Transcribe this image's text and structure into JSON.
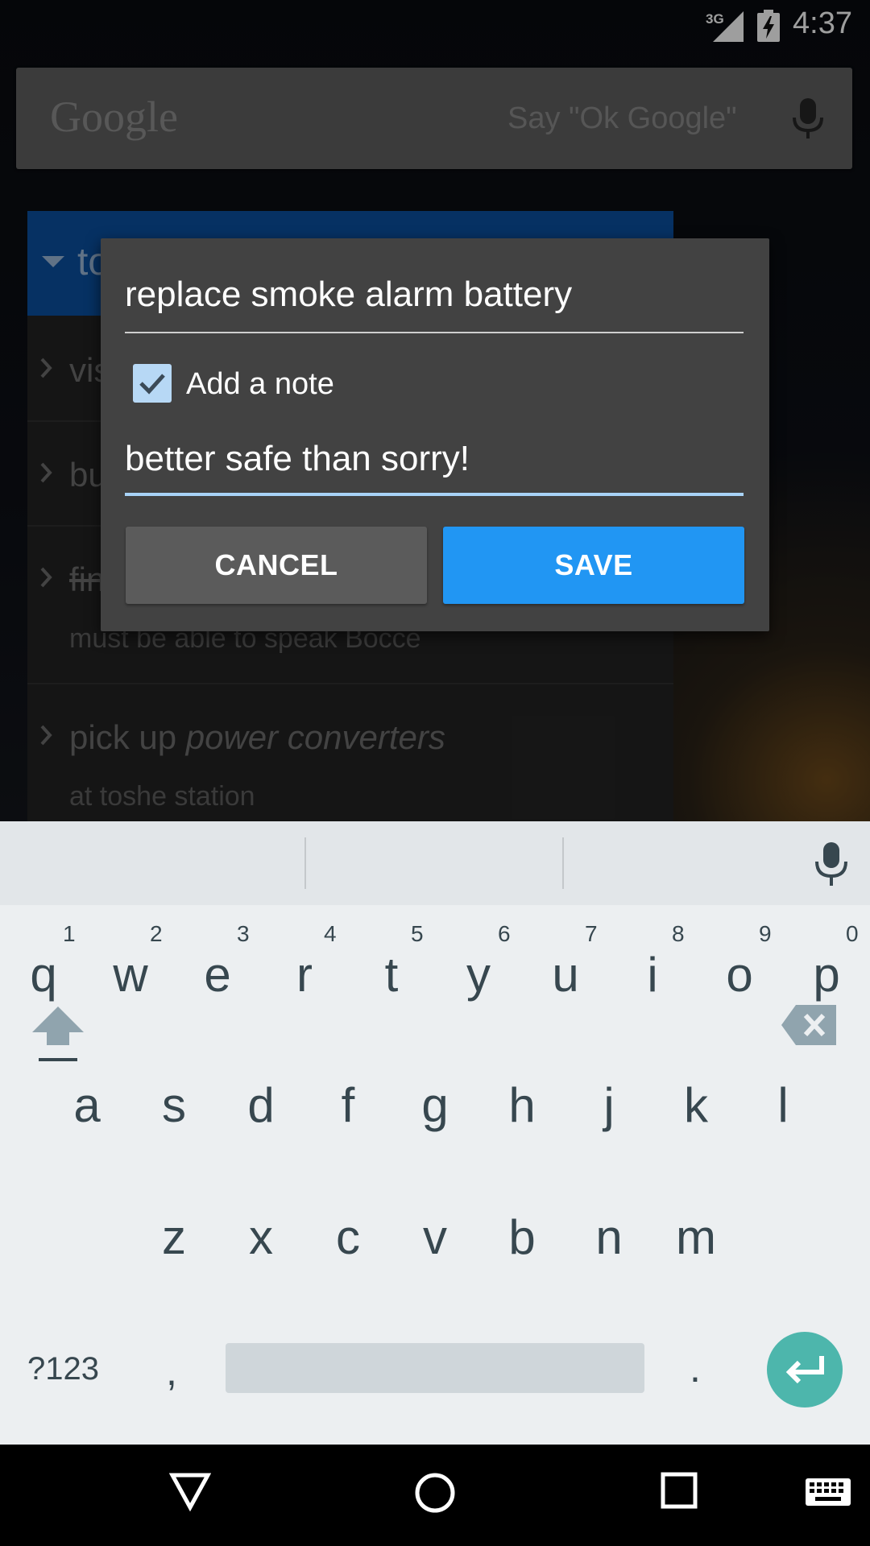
{
  "status_bar": {
    "network": "3G",
    "time": "4:37"
  },
  "search_widget": {
    "logo": "Google",
    "hint": "Say \"Ok Google\"",
    "mic_icon": "mic-icon"
  },
  "todo_list": {
    "header_title": "to",
    "items": [
      {
        "title": "vis"
      },
      {
        "title": "bu"
      },
      {
        "title": "fin",
        "strikethrough": true,
        "subtitle": "must be able to speak Bocce"
      },
      {
        "title_prefix": "pick up ",
        "title_emphasis": "power converters",
        "subtitle": "at toshe station"
      }
    ]
  },
  "dialog": {
    "title_value": "replace smoke alarm battery",
    "add_note_label": "Add a note",
    "add_note_checked": true,
    "note_value": "better safe than sorry!",
    "cancel_label": "CANCEL",
    "save_label": "SAVE",
    "colors": {
      "save": "#2196f3",
      "cancel": "#5b5b5b",
      "focus_underline": "#a9d3f7"
    }
  },
  "keyboard": {
    "row1": [
      "q",
      "w",
      "e",
      "r",
      "t",
      "y",
      "u",
      "i",
      "o",
      "p"
    ],
    "row1_hints": [
      "1",
      "2",
      "3",
      "4",
      "5",
      "6",
      "7",
      "8",
      "9",
      "0"
    ],
    "row2": [
      "a",
      "s",
      "d",
      "f",
      "g",
      "h",
      "j",
      "k",
      "l"
    ],
    "row3": [
      "z",
      "x",
      "c",
      "v",
      "b",
      "n",
      "m"
    ],
    "symbols_label": "?123",
    "comma": ",",
    "period": ".",
    "enter_color": "#4db6ac"
  },
  "nav_bar": {
    "icons": [
      "back-icon",
      "home-icon",
      "recents-icon",
      "keyboard-switch-icon"
    ]
  }
}
